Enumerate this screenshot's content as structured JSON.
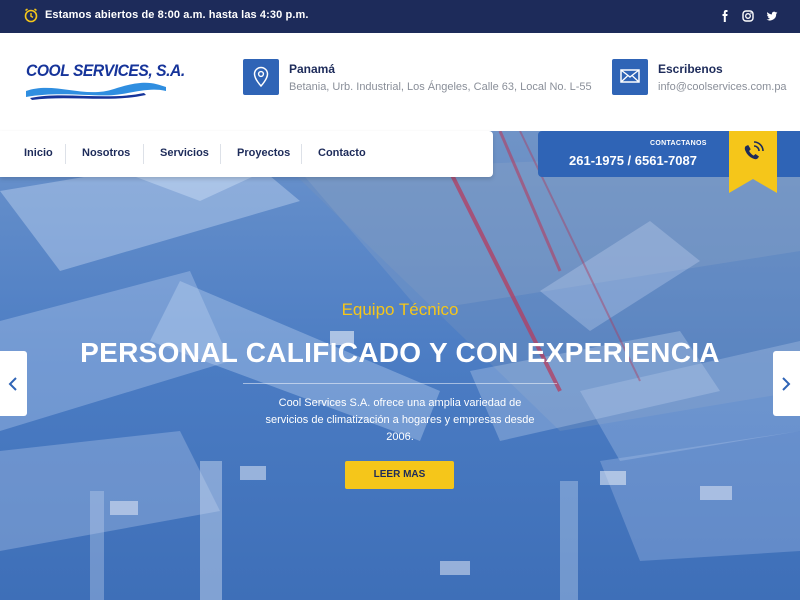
{
  "topbar": {
    "hours": "Estamos abiertos de 8:00 a.m. hasta las 4:30 p.m.",
    "social": [
      "facebook-icon",
      "instagram-icon",
      "twitter-icon"
    ],
    "background": "#1d2b5a"
  },
  "logo": {
    "text": "COOL SERVICES, S.A."
  },
  "location": {
    "title": "Panamá",
    "address": "Betania, Urb. Industrial, Los Ángeles, Calle 63, Local No. L-55"
  },
  "mail": {
    "title": "Escribenos",
    "email": "info@coolservices.com.pa"
  },
  "nav": {
    "items": [
      "Inicio",
      "Nosotros",
      "Servicios",
      "Proyectos",
      "Contacto"
    ]
  },
  "contact": {
    "label": "CONTACTANOS",
    "phones": "261-1975 / 6561-7087"
  },
  "hero": {
    "subtitle": "Equipo Técnico",
    "title": "PERSONAL CALIFICADO Y CON EXPERIENCIA",
    "description": "Cool Services S.A. ofrece una amplia variedad de servicios de climatización a hogares y empresas desde 2006.",
    "button": "LEER MAS"
  },
  "colors": {
    "accent": "#2f64b6",
    "yellow": "#f5c61a",
    "navy": "#1d2b5a"
  }
}
